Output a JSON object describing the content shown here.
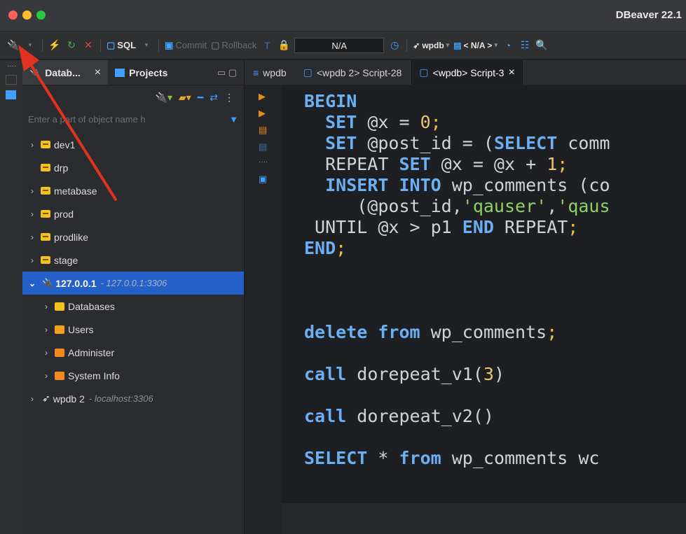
{
  "window": {
    "title": "DBeaver 22.1"
  },
  "toolbar": {
    "sql_label": "SQL",
    "commit_label": "Commit",
    "rollback_label": "Rollback",
    "transaction_field": "N/A",
    "connection_label": "wpdb",
    "schema_label": "< N/A >"
  },
  "navigator": {
    "tabs": [
      {
        "label": "Datab...",
        "icon": "database-icon",
        "closable": "×"
      },
      {
        "label": "Projects",
        "icon": "projects-icon"
      }
    ],
    "filter_placeholder": "Enter a part of object name h",
    "items": [
      {
        "label": "dev1",
        "expandable": true
      },
      {
        "label": "drp",
        "expandable": false
      },
      {
        "label": "metabase",
        "expandable": true
      },
      {
        "label": "prod",
        "expandable": true
      },
      {
        "label": "prodlike",
        "expandable": true
      },
      {
        "label": "stage",
        "expandable": true
      },
      {
        "label": "127.0.0.1",
        "detail": "- 127.0.0.1:3306",
        "selected": true,
        "expanded": true
      },
      {
        "label": "Databases",
        "icon": "databases-icon"
      },
      {
        "label": "Users",
        "icon": "users-icon"
      },
      {
        "label": "Administer",
        "icon": "administer-icon"
      },
      {
        "label": "System Info",
        "icon": "system-info-icon"
      },
      {
        "label": "wpdb 2",
        "detail": "- localhost:3306"
      }
    ]
  },
  "editor": {
    "tabs": [
      {
        "label": "wpdb",
        "icon": "connection-icon"
      },
      {
        "label": "<wpdb 2> Script-28",
        "icon": "script-icon"
      },
      {
        "label": "<wpdb> Script-3",
        "icon": "script-icon",
        "active": true,
        "close": "×"
      }
    ]
  },
  "colors": {
    "accent": "#2560c8",
    "keyword": "#6ab0f3",
    "string": "#90d165",
    "number": "#e8c66b",
    "annotation_arrow": "#e0321e"
  }
}
